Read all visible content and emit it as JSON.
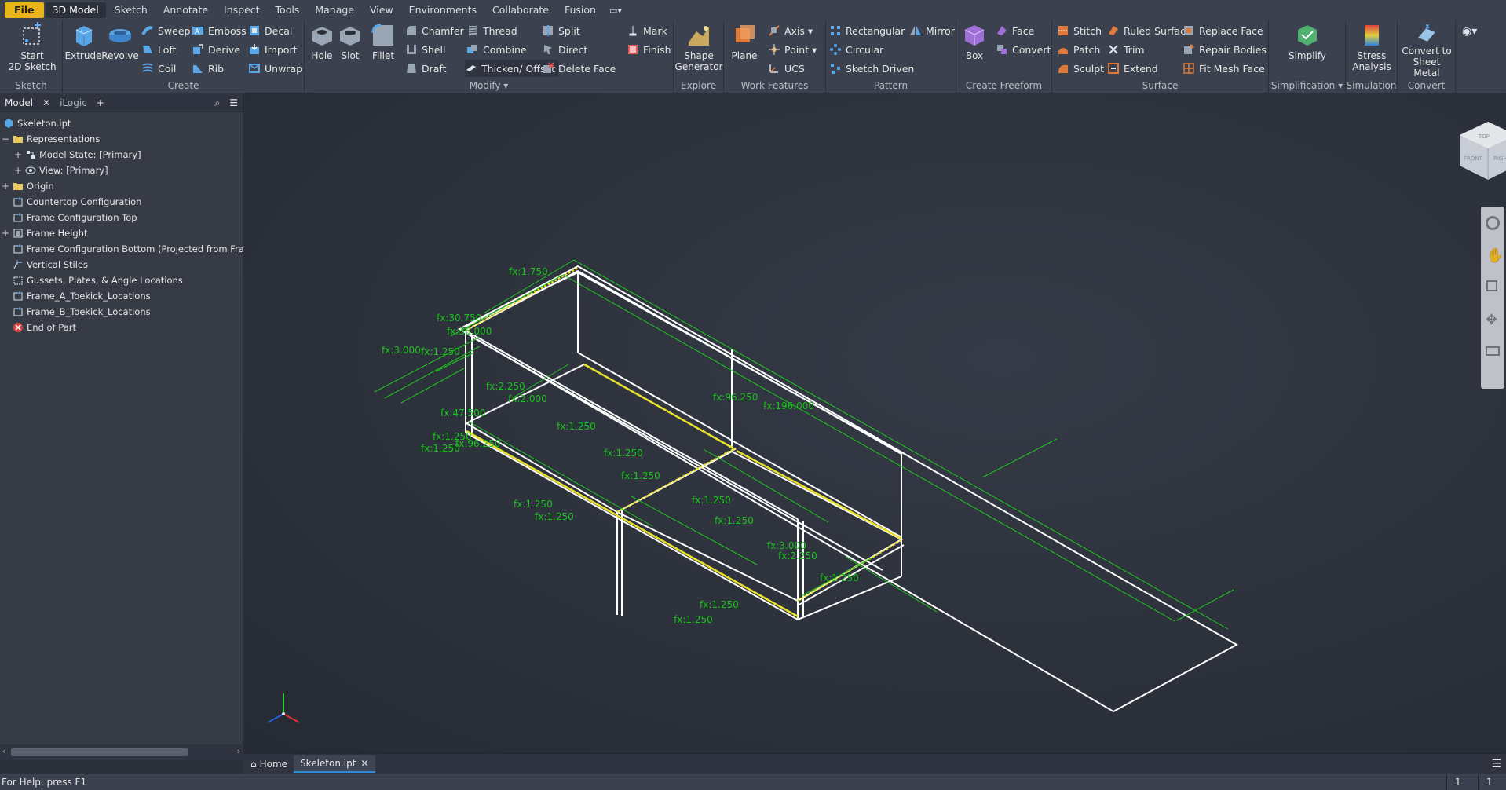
{
  "menu": {
    "tabs": [
      "File",
      "3D Model",
      "Sketch",
      "Annotate",
      "Inspect",
      "Tools",
      "Manage",
      "View",
      "Environments",
      "Collaborate",
      "Fusion"
    ],
    "active": "3D Model"
  },
  "ribbon": {
    "sketch": {
      "label": "Sketch",
      "start": "Start\n2D Sketch"
    },
    "create": {
      "label": "Create",
      "extrude": "Extrude",
      "revolve": "Revolve",
      "sweep": "Sweep",
      "loft": "Loft",
      "coil": "Coil",
      "emboss": "Emboss",
      "derive": "Derive",
      "rib": "Rib",
      "decal": "Decal",
      "import": "Import",
      "unwrap": "Unwrap"
    },
    "modify": {
      "label": "Modify",
      "hole": "Hole",
      "slot": "Slot",
      "fillet": "Fillet",
      "chamfer": "Chamfer",
      "shell": "Shell",
      "draft": "Draft",
      "thread": "Thread",
      "combine": "Combine",
      "thicken": "Thicken/ Offset",
      "split": "Split",
      "direct": "Direct",
      "delete_face": "Delete Face",
      "mark": "Mark",
      "finish": "Finish"
    },
    "explore": {
      "label": "Explore",
      "shape_gen": "Shape\nGenerator"
    },
    "work_features": {
      "label": "Work Features",
      "plane": "Plane",
      "axis": "Axis",
      "point": "Point",
      "ucs": "UCS"
    },
    "pattern": {
      "label": "Pattern",
      "rectangular": "Rectangular",
      "circular": "Circular",
      "sketch_driven": "Sketch Driven",
      "mirror": "Mirror"
    },
    "freeform": {
      "label": "Create Freeform",
      "box": "Box",
      "face": "Face",
      "convert": "Convert"
    },
    "surface": {
      "label": "Surface",
      "stitch": "Stitch",
      "patch": "Patch",
      "sculpt": "Sculpt",
      "ruled": "Ruled Surface",
      "trim": "Trim",
      "extend": "Extend",
      "replace_face": "Replace Face",
      "repair": "Repair Bodies",
      "fit_mesh": "Fit Mesh Face"
    },
    "simplification": {
      "label": "Simplification",
      "simplify": "Simplify"
    },
    "simulation": {
      "label": "Simulation",
      "stress": "Stress\nAnalysis"
    },
    "convert": {
      "label": "Convert",
      "sheet_metal": "Convert to\nSheet Metal"
    }
  },
  "browser": {
    "tabs": {
      "model": "Model",
      "ilogic": "iLogic"
    },
    "items": [
      {
        "label": "Skeleton.ipt",
        "indent": 0,
        "exp": ""
      },
      {
        "label": "Representations",
        "indent": 0,
        "exp": "−"
      },
      {
        "label": "Model State: [Primary]",
        "indent": 1,
        "exp": "+"
      },
      {
        "label": "View: [Primary]",
        "indent": 1,
        "exp": "+"
      },
      {
        "label": "Origin",
        "indent": 0,
        "exp": "+"
      },
      {
        "label": "Countertop Configuration",
        "indent": 0,
        "exp": ""
      },
      {
        "label": "Frame Configuration Top",
        "indent": 0,
        "exp": ""
      },
      {
        "label": "Frame Height",
        "indent": 0,
        "exp": "+"
      },
      {
        "label": "Frame Configuration Bottom (Projected from Frame Conf",
        "indent": 0,
        "exp": ""
      },
      {
        "label": "Vertical Stiles",
        "indent": 0,
        "exp": ""
      },
      {
        "label": "Gussets, Plates, & Angle Locations",
        "indent": 0,
        "exp": ""
      },
      {
        "label": "Frame_A_Toekick_Locations",
        "indent": 0,
        "exp": ""
      },
      {
        "label": "Frame_B_Toekick_Locations",
        "indent": 0,
        "exp": ""
      },
      {
        "label": "End of Part",
        "indent": 0,
        "exp": ""
      }
    ]
  },
  "viewport": {
    "dims": [
      "fx:1.750",
      "fx:30.750",
      "fx:36.000",
      "fx:3.000",
      "fx:1.250",
      "fx:96.250",
      "fx:196.000",
      "fx:2.250",
      "fx:2.000",
      "fx:47.500",
      "fx:1.250",
      "fx:96.250",
      "fx:1.250",
      "fx:1.250",
      "fx:1.250",
      "fx:1.250",
      "fx:1.250",
      "fx:1.250",
      "fx:1.250",
      "fx:3.000",
      "fx:2.250",
      "fx:1.250",
      "fx:1.250",
      "fx:1.250",
      "fx:1.250"
    ],
    "viewcube": {
      "top": "TOP",
      "front": "FRONT",
      "right": "RIGHT"
    }
  },
  "doctabs": {
    "home": "Home",
    "file": "Skeleton.ipt"
  },
  "status": {
    "help": "For Help, press F1",
    "count1": "1",
    "count2": "1"
  }
}
